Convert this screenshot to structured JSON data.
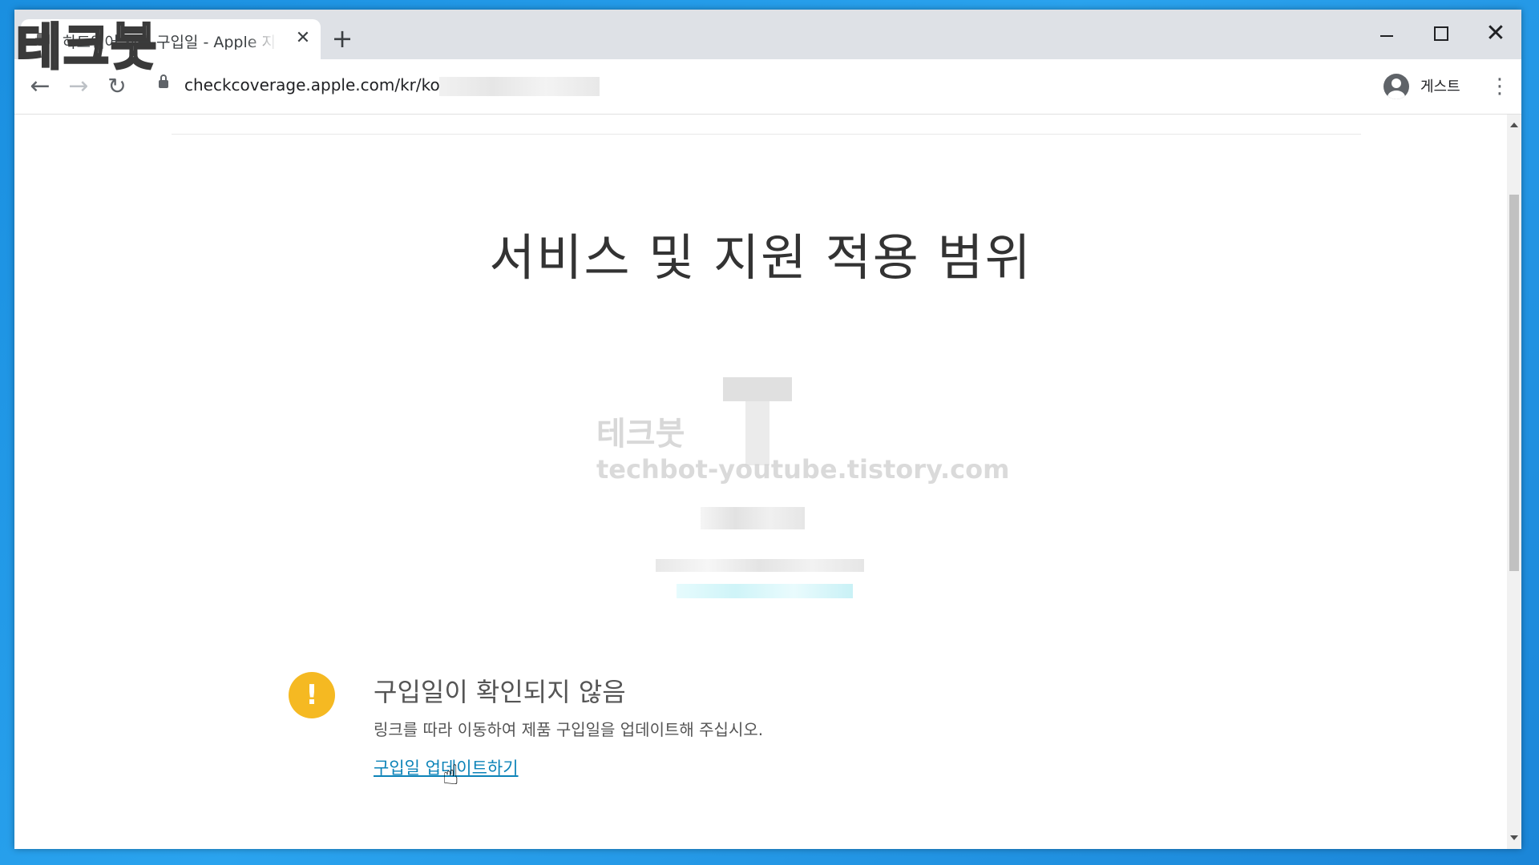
{
  "browser": {
    "tab_title": "하드웨어 제품 구입일 - Apple 지원",
    "new_tab_glyph": "+",
    "close_tab_glyph": "✕",
    "url": "checkcoverage.apple.com/kr/ko/?",
    "profile_label": "게스트",
    "icons": {
      "back": "arrow-left-icon",
      "forward": "arrow-right-icon",
      "reload": "reload-icon",
      "lock": "lock-icon",
      "profile": "person-icon",
      "menu": "three-dots-icon"
    }
  },
  "page": {
    "title": "서비스 및 지원 적용 범위",
    "alert": {
      "title": "구입일이 확인되지 않음",
      "description": "링크를 따라 이동하여 제품 구입일을 업데이트해 주십시오.",
      "link_label": "구입일 업데이트하기",
      "icon_glyph": "!",
      "icon_color": "#f5b922"
    }
  },
  "watermark": {
    "logo": "테크붓",
    "name": "테크붓",
    "url": "techbot-youtube.tistory.com"
  },
  "colors": {
    "link": "#0c83b8",
    "title_text": "#333333",
    "desktop_blue": "#1a8fe0"
  }
}
